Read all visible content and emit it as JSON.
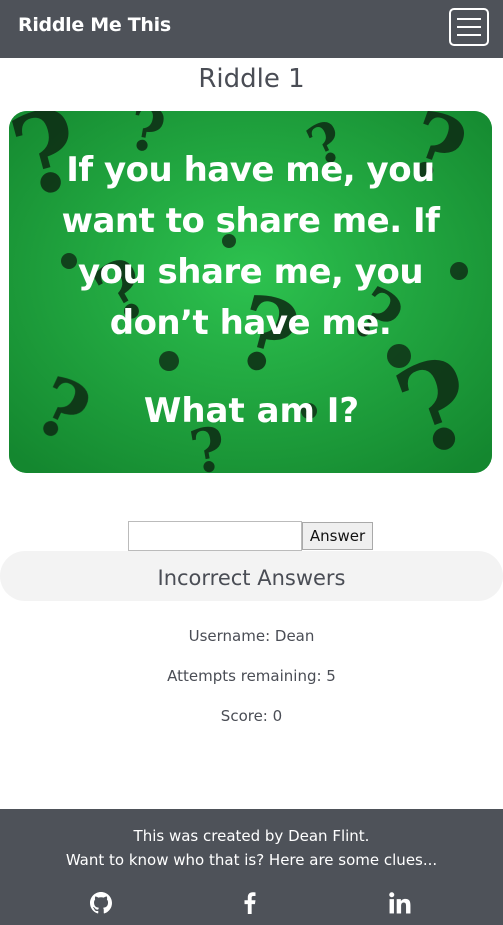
{
  "navbar": {
    "brand": "Riddle Me This",
    "menu_icon": "hamburger-menu-icon"
  },
  "main": {
    "title": "Riddle 1",
    "riddle": {
      "lines": [
        "If you have me, you",
        "want to share me. If",
        "you share me, you",
        "don’t have me."
      ],
      "question": "What am I?",
      "background_color": "#1ea33f",
      "decoration": "question-marks-icon"
    },
    "answer_input": {
      "value": "",
      "placeholder": ""
    },
    "answer_button_label": "Answer",
    "incorrect_title": "Incorrect Answers",
    "stats": {
      "username": "Username: Dean",
      "attempts": "Attempts remaining: 5",
      "score": "Score: 0"
    }
  },
  "footer": {
    "line1": "This was created by Dean Flint.",
    "line2": "Want to know who that is? Here are some clues...",
    "icons": [
      "github-icon",
      "facebook-icon",
      "linkedin-icon"
    ]
  },
  "colors": {
    "header_footer": "#4e5259",
    "text": "#4a4d55",
    "band": "#f3f3f3"
  }
}
